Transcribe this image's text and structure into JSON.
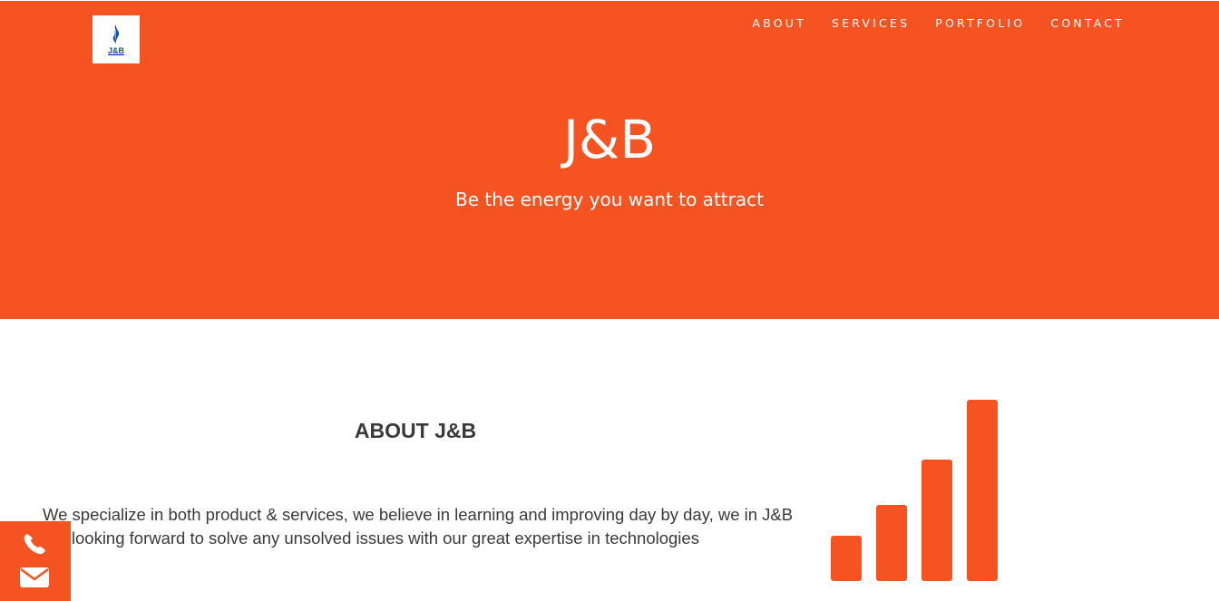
{
  "brand": {
    "logo_text": "J&B",
    "accent_color": "#f55321",
    "logo_color": "#1c4fa1"
  },
  "nav": {
    "items": [
      {
        "label": "ABOUT"
      },
      {
        "label": "SERVICES"
      },
      {
        "label": "PORTFOLIO"
      },
      {
        "label": "CONTACT"
      }
    ]
  },
  "hero": {
    "title": "J&B",
    "subtitle": "Be the energy you want to attract"
  },
  "about": {
    "title": "ABOUT J&B",
    "body": "We specialize in both product & services, we believe in learning and improving day by day, we in J&B are looking forward to solve any unsolved issues with our great expertise in technologies"
  },
  "graphic": {
    "icon": "signal-bars-icon",
    "bar_levels": [
      0.25,
      0.42,
      0.67,
      1.0
    ]
  },
  "floating_contact": {
    "icons": [
      "phone-icon",
      "mail-icon"
    ]
  }
}
